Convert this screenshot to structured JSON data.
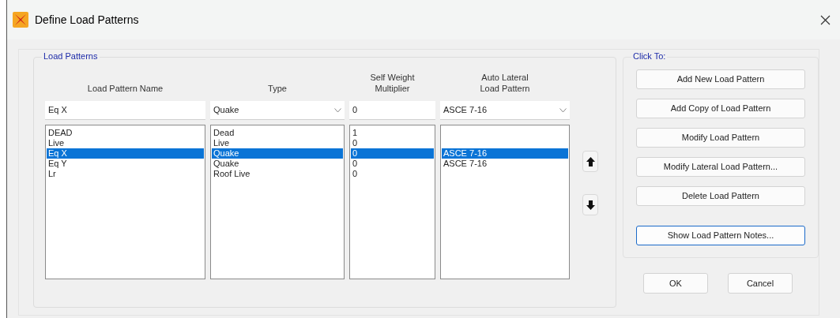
{
  "window": {
    "title": "Define Load Patterns"
  },
  "load_patterns": {
    "title": "Load Patterns",
    "columns": [
      "Load Pattern Name",
      "Type",
      "Self Weight Multiplier",
      "Auto Lateral Load Pattern"
    ],
    "edit_row": {
      "name": "Eq X",
      "type": "Quake",
      "multiplier": "0",
      "lateral": "ASCE 7-16"
    },
    "rows": [
      {
        "name": "DEAD",
        "type": "Dead",
        "multiplier": "1",
        "lateral": "",
        "selected": false
      },
      {
        "name": "Live",
        "type": "Live",
        "multiplier": "0",
        "lateral": "",
        "selected": false
      },
      {
        "name": "Eq X",
        "type": "Quake",
        "multiplier": "0",
        "lateral": "ASCE 7-16",
        "selected": true
      },
      {
        "name": "Eq Y",
        "type": "Quake",
        "multiplier": "0",
        "lateral": "ASCE 7-16",
        "selected": false
      },
      {
        "name": "Lr",
        "type": "Roof Live",
        "multiplier": "0",
        "lateral": "",
        "selected": false
      }
    ]
  },
  "click_to": {
    "title": "Click To:",
    "buttons": [
      {
        "label": "Add New Load Pattern",
        "focused": false
      },
      {
        "label": "Add Copy of Load Pattern",
        "focused": false
      },
      {
        "label": "Modify Load Pattern",
        "focused": false
      },
      {
        "label": "Modify Lateral Load Pattern...",
        "focused": false
      },
      {
        "label": "Delete Load Pattern",
        "focused": false
      },
      {
        "label": "Show Load Pattern Notes...",
        "focused": true
      }
    ]
  },
  "buttons": [
    "OK",
    "Cancel"
  ]
}
